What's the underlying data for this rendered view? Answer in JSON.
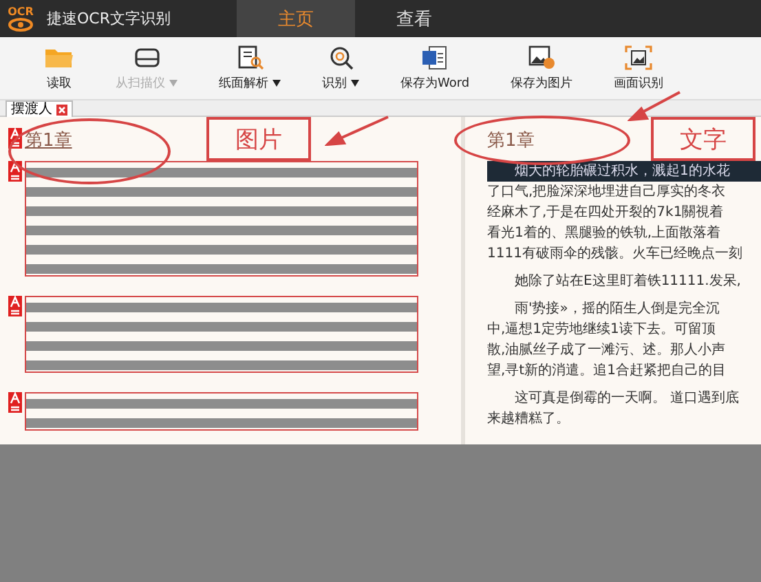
{
  "app": {
    "logo": "OCR",
    "title": "捷速OCR文字识别"
  },
  "tabs": [
    {
      "label": "主页",
      "selected": true
    },
    {
      "label": "查看",
      "selected": false
    }
  ],
  "toolbar": [
    {
      "label": "读取",
      "kind": "folder",
      "disabled": false,
      "dropdown": false
    },
    {
      "label": "从扫描仪",
      "kind": "scanner",
      "disabled": true,
      "dropdown": true
    },
    {
      "label": "纸面解析",
      "kind": "analyze",
      "disabled": false,
      "dropdown": true
    },
    {
      "label": "识别",
      "kind": "recognize",
      "disabled": false,
      "dropdown": true
    },
    {
      "label": "保存为Word",
      "kind": "word",
      "disabled": false,
      "dropdown": false
    },
    {
      "label": "保存为图片",
      "kind": "image",
      "disabled": false,
      "dropdown": false
    },
    {
      "label": "画面识别",
      "kind": "frame",
      "disabled": false,
      "dropdown": false
    }
  ],
  "documents": [
    {
      "label": "摆渡人",
      "selected": true
    }
  ],
  "image_page": {
    "heading": "第1章",
    "blocks": [
      {
        "kind": "long"
      },
      {
        "kind": "medium"
      },
      {
        "kind": "short"
      }
    ]
  },
  "text_page": {
    "heading": "第1章",
    "paragraphs": [
      {
        "lines": [
          "烟大的轮胎碾过积水，溅起1的水花",
          "了口气,把脸深深地埋进自己厚实的冬衣",
          "经麻木了,于是在四处开裂的7k1關視着",
          "看光1着的、黑腿验的铁轨,上面散落着",
          "1111有破雨伞的残骸。火车已经晚点一刻"
        ],
        "highlighted": true
      },
      {
        "lines": [
          "她除了站在E这里盯着铁11111.发呆,"
        ],
        "highlighted": false
      },
      {
        "lines": [
          "雨'势接»，摇的陌生人倒是完全沉",
          "中,逼想1定劳地继续1读下去。可留顶",
          "散,油腻丝子成了一滩污、述。那人小声",
          "望,寻t新的消遣。追1合赶紧把自己的目"
        ],
        "highlighted": false
      },
      {
        "lines": [
          "这可真是倒霉的一天啊。 道口遇到底",
          "来越糟糕了。"
        ],
        "highlighted": false
      }
    ]
  },
  "annotations": [
    {
      "label": "图片"
    },
    {
      "label": "文字"
    }
  ]
}
